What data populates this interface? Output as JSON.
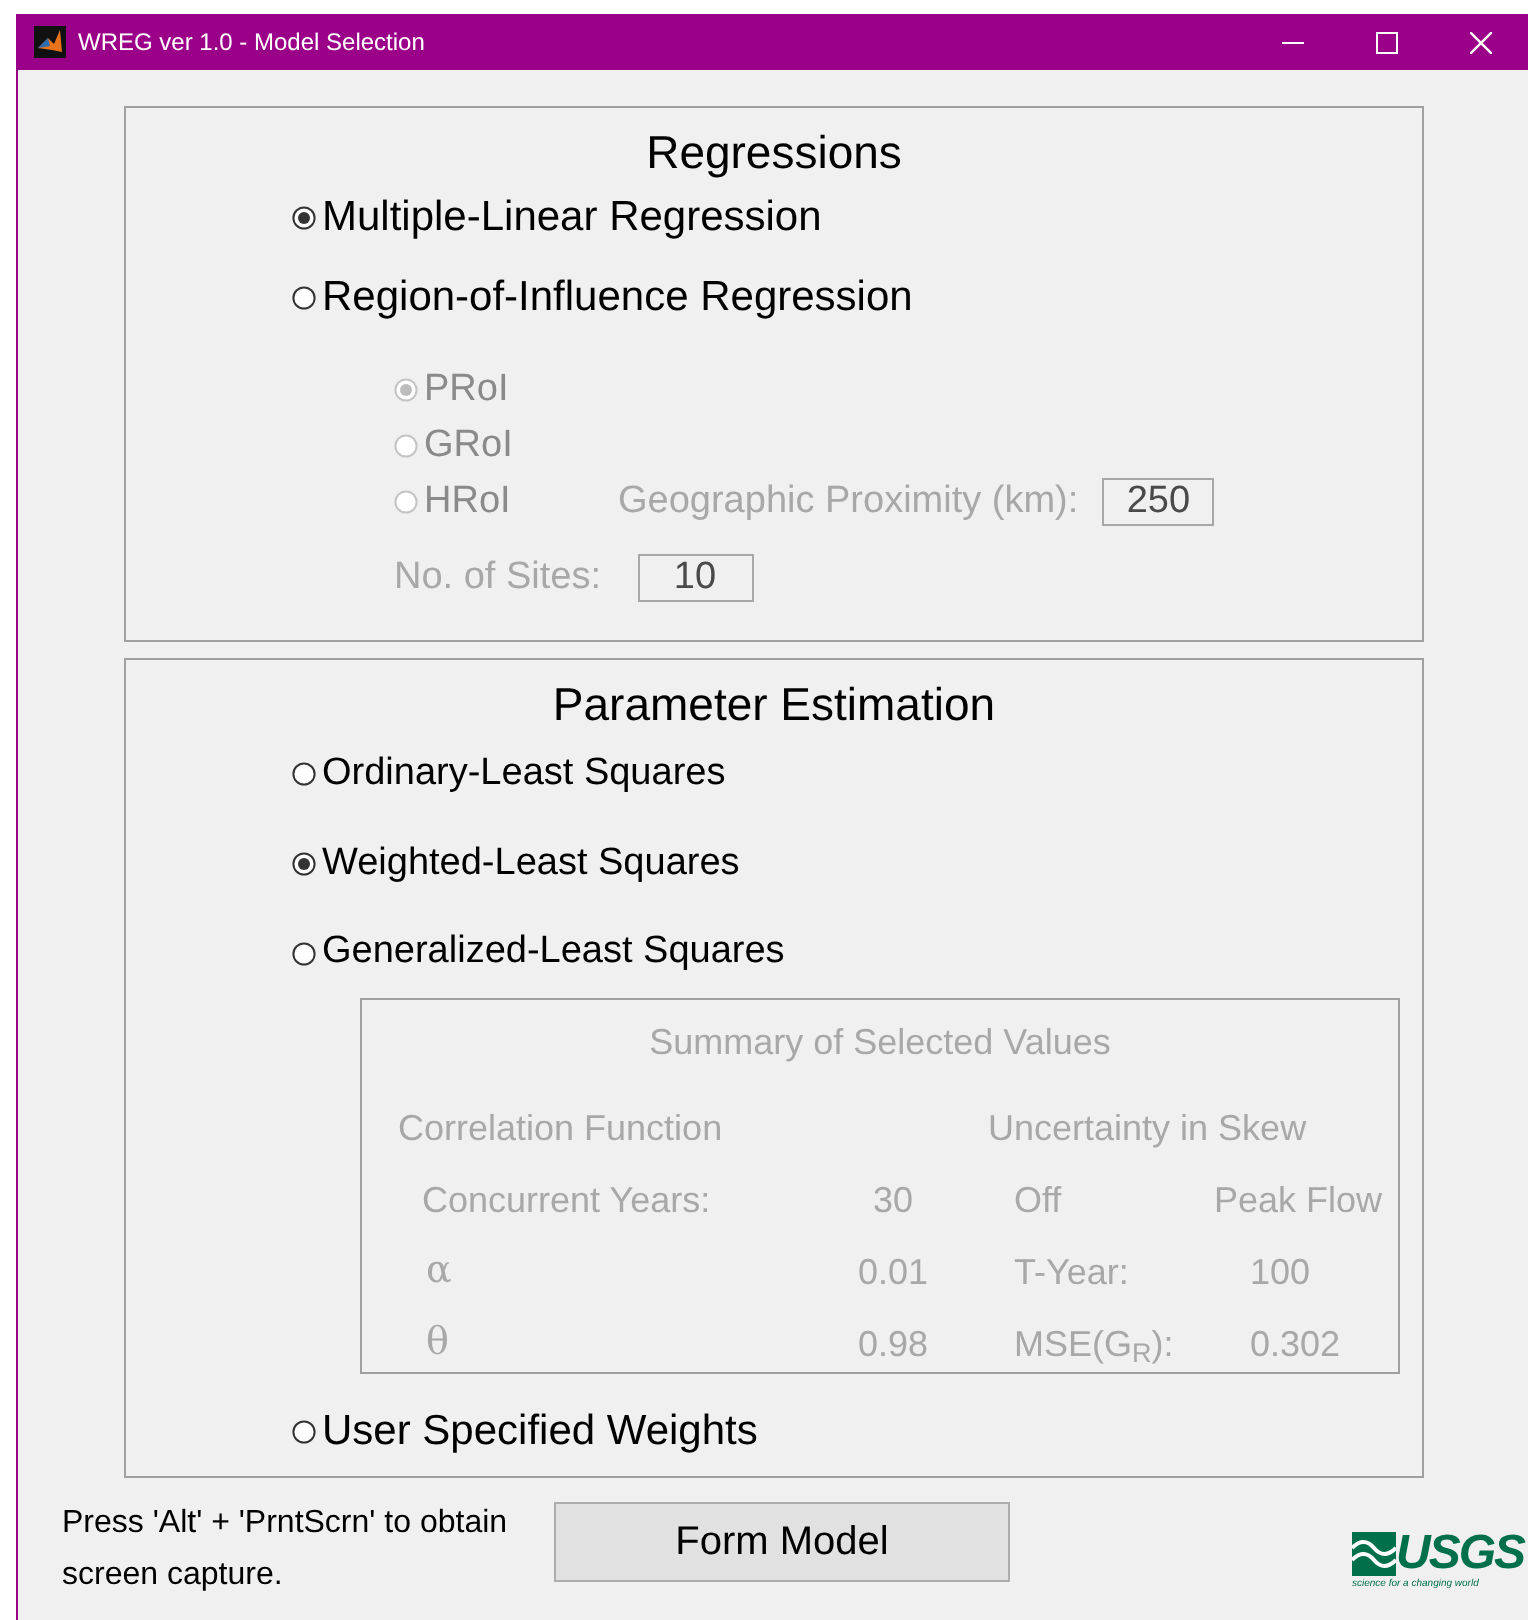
{
  "window": {
    "title": "WREG ver 1.0 - Model Selection"
  },
  "regressions": {
    "title": "Regressions",
    "options": [
      {
        "label": "Multiple-Linear Regression",
        "selected": true
      },
      {
        "label": "Region-of-Influence Regression",
        "selected": false
      }
    ],
    "roi": {
      "disabled": true,
      "options": [
        {
          "label": "PRoI",
          "selected": true
        },
        {
          "label": "GRoI",
          "selected": false
        },
        {
          "label": "HRoI",
          "selected": false
        }
      ],
      "proximity": {
        "label": "Geographic Proximity (km):",
        "value": "250"
      },
      "sites": {
        "label": "No. of Sites:",
        "value": "10"
      }
    }
  },
  "parameter_estimation": {
    "title": "Parameter Estimation",
    "options": [
      {
        "label": "Ordinary-Least Squares",
        "selected": false
      },
      {
        "label": "Weighted-Least Squares",
        "selected": true
      },
      {
        "label": "Generalized-Least Squares",
        "selected": false,
        "summary": {
          "disabled": true,
          "title": "Summary of Selected Values",
          "correlation_heading": "Correlation Function",
          "skew_heading": "Uncertainty in Skew",
          "left_rows": [
            {
              "label": "Concurrent Years:",
              "value": "30"
            },
            {
              "label": "α",
              "value": "0.01"
            },
            {
              "label": "θ",
              "value": "0.98"
            }
          ],
          "right_rows": [
            {
              "label": "Off",
              "value": "Peak Flow"
            },
            {
              "label": "T-Year:",
              "value": "100"
            },
            {
              "label": "MSE(G$_{R}$):",
              "value": "0.302"
            }
          ]
        }
      },
      {
        "label": "User Specified Weights",
        "selected": false
      }
    ]
  },
  "footer": {
    "note": "Press 'Alt' + 'PrntScrn' to obtain screen capture.",
    "button": "Form Model",
    "logo": {
      "text": "USGS",
      "tagline": "science for a changing world"
    }
  }
}
